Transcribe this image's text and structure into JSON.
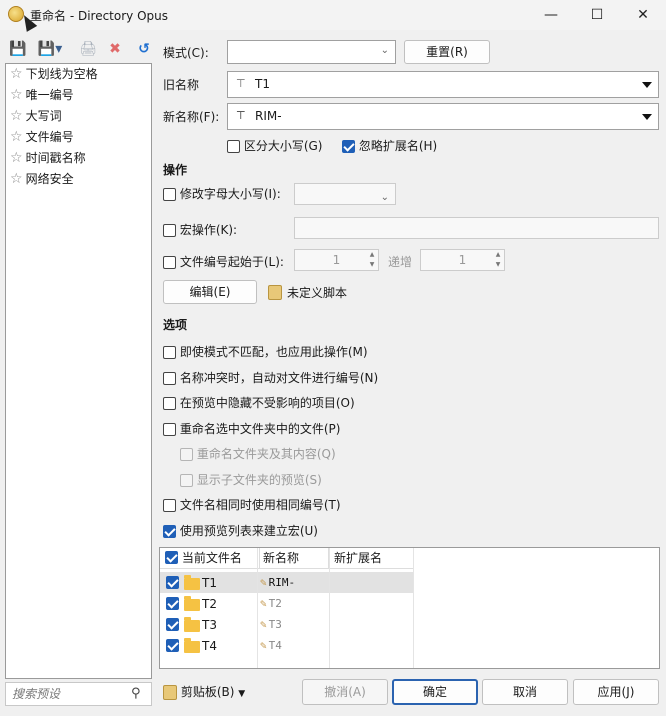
{
  "window": {
    "title": "重命名 - Directory Opus",
    "minimize": "—",
    "maximize": "☐",
    "close": "✕"
  },
  "toolbar": {
    "save_icon": "💾",
    "save_menu_icon": "💾▾",
    "print_icon": "🖨",
    "delete_icon": "✖",
    "undo_icon": "↺"
  },
  "presets": [
    "下划线为空格",
    "唯一编号",
    "大写词",
    "文件编号",
    "时间戳名称",
    "网络安全"
  ],
  "search": {
    "placeholder": "搜索预设"
  },
  "form": {
    "mode_label": "模式(C):",
    "mode_value": "",
    "reset_label": "重置(R)",
    "old_name_label": "旧名称",
    "old_name_value": "T1",
    "new_name_label": "新名称(F):",
    "new_name_value": "RIM-",
    "case_sensitive_label": "区分大小写(G)",
    "case_sensitive": false,
    "ignore_ext_label": "忽略扩展名(H)",
    "ignore_ext": true
  },
  "operations": {
    "title": "操作",
    "case_label": "修改字母大小写(I):",
    "macro_label": "宏操作(K):",
    "numbering_label": "文件编号起始于(L):",
    "numbering_start": "1",
    "increment_label": "递增",
    "increment_value": "1",
    "edit_label": "编辑(E)",
    "script_label": "未定义脚本"
  },
  "options": {
    "title": "选项",
    "items": [
      {
        "label": "即使模式不匹配，也应用此操作(M)",
        "checked": false,
        "disabled": false
      },
      {
        "label": "名称冲突时，自动对文件进行编号(N)",
        "checked": false,
        "disabled": false
      },
      {
        "label": "在预览中隐藏不受影响的项目(O)",
        "checked": false,
        "disabled": false
      },
      {
        "label": "重命名选中文件夹中的文件(P)",
        "checked": false,
        "disabled": false
      },
      {
        "label": "重命名文件夹及其内容(Q)",
        "checked": false,
        "disabled": true
      },
      {
        "label": "显示子文件夹的预览(S)",
        "checked": false,
        "disabled": true
      },
      {
        "label": "文件名相同时使用相同编号(T)",
        "checked": false,
        "disabled": false
      },
      {
        "label": "使用预览列表来建立宏(U)",
        "checked": true,
        "disabled": false
      }
    ]
  },
  "preview": {
    "columns": [
      "当前文件名",
      "新名称",
      "新扩展名"
    ],
    "rows": [
      {
        "current": "T1",
        "new": "RIM-",
        "ext": ""
      },
      {
        "current": "T2",
        "new": "T2",
        "ext": ""
      },
      {
        "current": "T3",
        "new": "T3",
        "ext": ""
      },
      {
        "current": "T4",
        "new": "T4",
        "ext": ""
      }
    ]
  },
  "footer": {
    "clipboard_label": "剪贴板(B)",
    "undo_label": "撤消(A)",
    "ok_label": "确定",
    "cancel_label": "取消",
    "apply_label": "应用(J)"
  }
}
